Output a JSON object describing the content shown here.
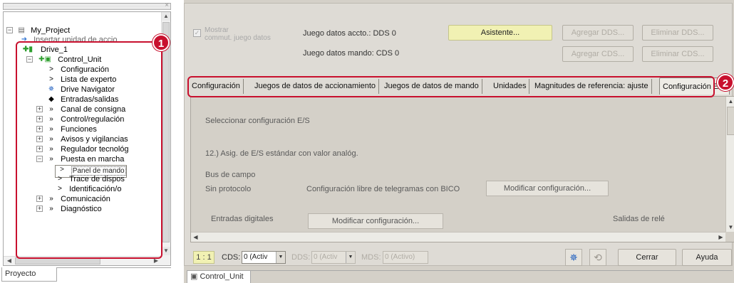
{
  "project_tree": {
    "items": [
      {
        "label": "My_Project",
        "icon": "project-icon",
        "expander": "−"
      },
      {
        "label": "Insertar unidad de accio",
        "icon": "insert-unit-icon",
        "expander": ""
      },
      {
        "label": "Drive_1",
        "icon": "drive-icon",
        "expander": ""
      },
      {
        "label": "Control_Unit",
        "icon": "control-unit-icon",
        "expander": "−"
      },
      {
        "label": "Configuración",
        "icon": "chevron-right-icon",
        "expander": ""
      },
      {
        "label": "Lista de experto",
        "icon": "chevron-right-icon",
        "expander": ""
      },
      {
        "label": "Drive Navigator",
        "icon": "navigator-icon",
        "expander": ""
      },
      {
        "label": "Entradas/salidas",
        "icon": "io-icon",
        "expander": ""
      },
      {
        "label": "Canal de consigna",
        "icon": "double-chevron-icon",
        "expander": "+"
      },
      {
        "label": "Control/regulación",
        "icon": "double-chevron-icon",
        "expander": "+"
      },
      {
        "label": "Funciones",
        "icon": "double-chevron-icon",
        "expander": "+"
      },
      {
        "label": "Avisos y vigilancias",
        "icon": "double-chevron-icon",
        "expander": "+"
      },
      {
        "label": "Regulador tecnológ",
        "icon": "double-chevron-icon",
        "expander": "+"
      },
      {
        "label": "Puesta en marcha",
        "icon": "double-chevron-icon",
        "expander": "−"
      },
      {
        "label": "Panel de mando",
        "icon": "chevron-right-icon",
        "expander": ""
      },
      {
        "label": "Trace de dispos",
        "icon": "chevron-right-icon",
        "expander": ""
      },
      {
        "label": "Identificación/o",
        "icon": "chevron-right-icon",
        "expander": ""
      },
      {
        "label": "Comunicación",
        "icon": "double-chevron-icon",
        "expander": "+"
      },
      {
        "label": "Diagnóstico",
        "icon": "double-chevron-icon",
        "expander": "+"
      }
    ],
    "bottom_tab": "Proyecto"
  },
  "callouts": {
    "one": "1",
    "two": "2"
  },
  "dialog": {
    "show_checkbox_label": "Mostrar\ncommut. juego datos",
    "drive_dataset_label": "Juego datos accto.: DDS 0",
    "command_dataset_label": "Juego datos mando:  CDS 0",
    "wizard_button": "Asistente...",
    "add_dds_button": "Agregar DDS...",
    "delete_dds_button": "Eliminar DDS...",
    "add_cds_button": "Agregar CDS...",
    "delete_cds_button": "Eliminar CDS...",
    "tabs": [
      "Configuración",
      "Juegos de datos de accionamiento",
      "Juegos de datos de mando",
      "Unidades",
      "Magnitudes de referencia: ajuste",
      "Configuración E/S"
    ],
    "active_tab": "Configuración E/S",
    "content": {
      "select_io_config": "Seleccionar configuración E/S",
      "assignment_text": "12.) Asig. de E/S estándar con valor analóg.",
      "fieldbus_label": "Bus de campo",
      "no_protocol_label": "Sin protocolo",
      "bico_label": "Configuración libre de telegramas con BICO",
      "modify_config_button": "Modificar configuración...",
      "digital_inputs_label": "Entradas digitales",
      "modify_config_button_2": "Modificar configuración...",
      "relay_outputs_label": "Salidas de relé"
    },
    "footer": {
      "ratio": "1 : 1",
      "cds_label": "CDS:",
      "cds_value": "0 (Activ",
      "dds_label": "DDS:",
      "dds_value": "0 (Activ",
      "mds_label": "MDS:",
      "mds_value": "0 (Activo)",
      "close_button": "Cerrar",
      "help_button": "Ayuda"
    }
  },
  "status_tab": "Control_Unit",
  "colors": {
    "annotation_red": "#c8102e",
    "highlight_yellow": "#f1f1b3"
  }
}
